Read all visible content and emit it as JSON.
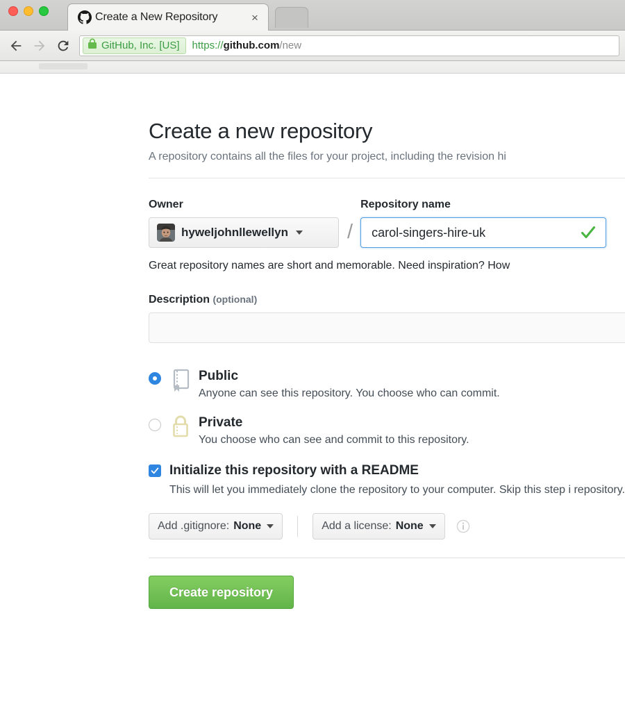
{
  "browser": {
    "tab": {
      "title": "Create a New Repository",
      "favicon": "github-octocat-icon",
      "close_label": "×"
    },
    "toolbar": {
      "back_icon": "back-arrow-icon",
      "forward_icon": "forward-arrow-icon",
      "reload_icon": "reload-icon"
    },
    "url": {
      "lock_icon": "lock-icon",
      "ev_label": "GitHub, Inc. [US]",
      "scheme": "https://",
      "host": "github.com",
      "path": "/new"
    }
  },
  "page": {
    "title": "Create a new repository",
    "subtitle": "A repository contains all the files for your project, including the revision hi",
    "owner": {
      "label": "Owner",
      "name": "hyweljohnllewellyn",
      "avatar": "user-avatar"
    },
    "separator": "/",
    "repository": {
      "label": "Repository name",
      "value": "carol-singers-hire-uk",
      "valid_icon": "green-check-icon"
    },
    "name_hint": "Great repository names are short and memorable. Need inspiration? How",
    "description": {
      "label": "Description",
      "optional": "(optional)",
      "value": "",
      "placeholder": ""
    },
    "visibility": {
      "options": [
        {
          "id": "public",
          "title": "Public",
          "desc": "Anyone can see this repository. You choose who can commit.",
          "selected": true,
          "icon": "repo-book-icon"
        },
        {
          "id": "private",
          "title": "Private",
          "desc": "You choose who can see and commit to this repository.",
          "selected": false,
          "icon": "lock-icon"
        }
      ]
    },
    "readme": {
      "title": "Initialize this repository with a README",
      "desc": "This will let you immediately clone the repository to your computer. Skip this step i repository.",
      "checked": true
    },
    "gitignore": {
      "label": "Add .gitignore:",
      "value": "None"
    },
    "license": {
      "label": "Add a license:",
      "value": "None",
      "info_icon": "info-icon"
    },
    "submit": {
      "label": "Create repository"
    }
  },
  "colors": {
    "accent_green": "#62b44a",
    "accent_blue": "#2f86e0",
    "ev_green": "#3a9c43",
    "lock_yellow": "#e3dcab",
    "repo_gray": "#b5bcc4"
  }
}
